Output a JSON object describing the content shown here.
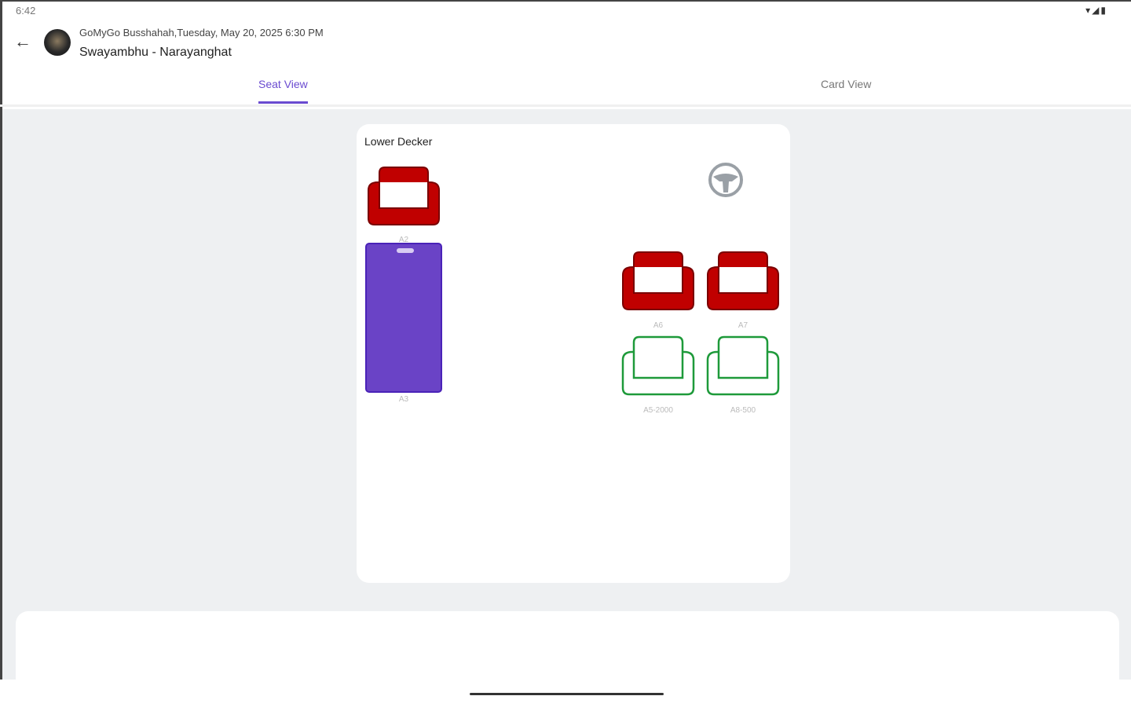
{
  "status_bar": {
    "time": "6:42",
    "icons": "▾◢▮"
  },
  "header": {
    "subtitle": "GoMyGo Busshahah,Tuesday, May 20, 2025 6:30 PM",
    "title": "Swayambhu - Narayanghat"
  },
  "tabs": [
    {
      "label": "Seat View",
      "active": true
    },
    {
      "label": "Card View",
      "active": false
    }
  ],
  "deck": {
    "title": "Lower Decker",
    "seats": [
      {
        "label": "A2",
        "status": "booked"
      },
      {
        "label": "A3",
        "status": "selected-sleeper"
      },
      {
        "label": "A6",
        "status": "booked"
      },
      {
        "label": "A7",
        "status": "booked"
      },
      {
        "label": "A5-2000",
        "status": "available"
      },
      {
        "label": "A8-500",
        "status": "available"
      }
    ]
  },
  "colors": {
    "booked": "#c00000",
    "available": "#1e9a3a",
    "selected": "#6a43c6",
    "accent": "#6a4bd0"
  }
}
